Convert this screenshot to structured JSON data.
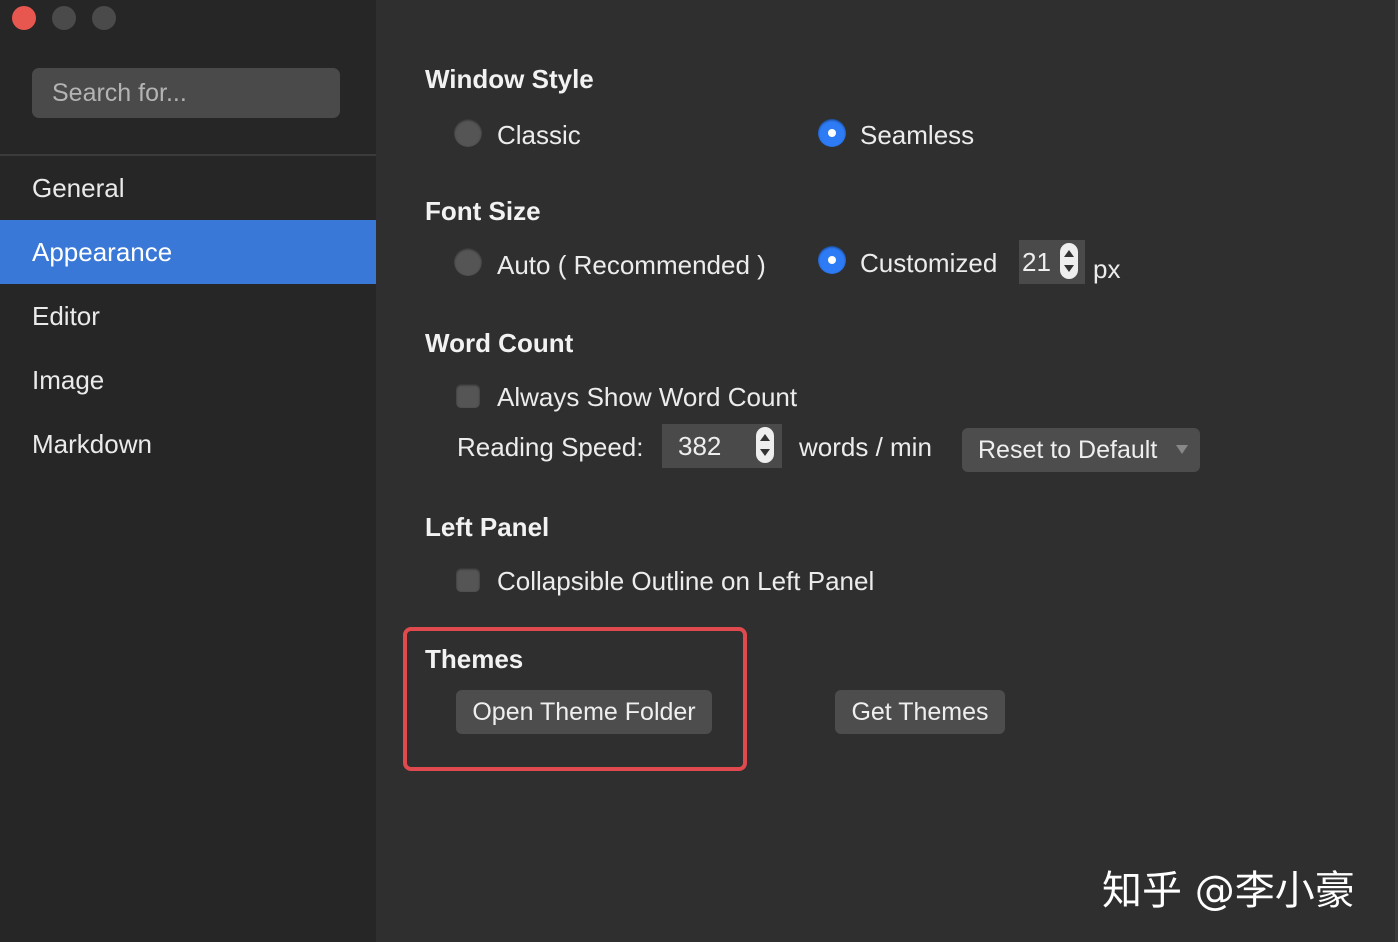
{
  "sidebar": {
    "search_placeholder": "Search for...",
    "items": [
      {
        "label": "General"
      },
      {
        "label": "Appearance",
        "active": true
      },
      {
        "label": "Editor"
      },
      {
        "label": "Image"
      },
      {
        "label": "Markdown"
      }
    ]
  },
  "window_style": {
    "heading": "Window Style",
    "options": [
      {
        "label": "Classic",
        "selected": false
      },
      {
        "label": "Seamless",
        "selected": true
      }
    ]
  },
  "font_size": {
    "heading": "Font Size",
    "auto_label": "Auto ( Recommended )",
    "custom_label": "Customized",
    "value": "21",
    "unit": "px",
    "selected": "Customized"
  },
  "word_count": {
    "heading": "Word Count",
    "always_show_label": "Always Show Word Count",
    "always_show_checked": false,
    "reading_speed_label": "Reading Speed:",
    "reading_speed_value": "382",
    "unit": "words / min",
    "reset_label": "Reset to Default"
  },
  "left_panel": {
    "heading": "Left Panel",
    "collapsible_label": "Collapsible Outline on Left Panel",
    "collapsible_checked": false
  },
  "themes": {
    "heading": "Themes",
    "open_folder_label": "Open Theme Folder",
    "get_themes_label": "Get Themes"
  },
  "watermark": "知乎 @李小豪",
  "colors": {
    "accent": "#3a78d8",
    "radio_on": "#2e7bf6",
    "highlight_border": "#e04a4f",
    "close_button": "#e8574f"
  }
}
